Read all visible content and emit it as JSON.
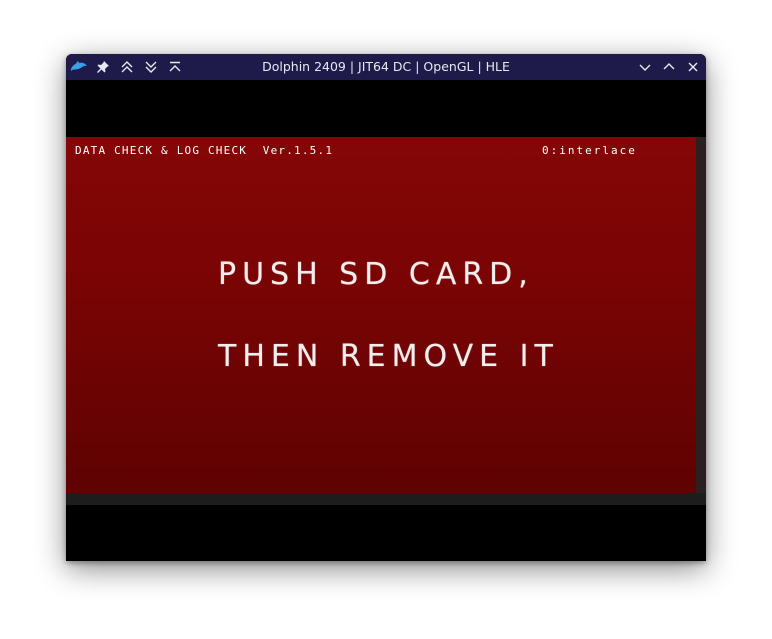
{
  "window": {
    "title": "Dolphin 2409 | JIT64 DC | OpenGL | HLE"
  },
  "titlebar_icons": {
    "left": [
      "dolphin-logo-icon",
      "pin-icon",
      "chevron-double-up-icon",
      "chevron-double-down-icon",
      "collapse-top-icon"
    ],
    "right": [
      "minimize-icon",
      "maximize-icon",
      "close-icon"
    ]
  },
  "game_screen": {
    "header_left": "DATA CHECK & LOG CHECK  Ver.1.5.1",
    "header_right": "0:interlace",
    "message_line1": "PUSH SD CARD,",
    "message_line2": "THEN REMOVE IT"
  },
  "colors": {
    "titlebar": "#1e1a4a",
    "screen_red": "#7a0404",
    "text": "#ffffff"
  }
}
